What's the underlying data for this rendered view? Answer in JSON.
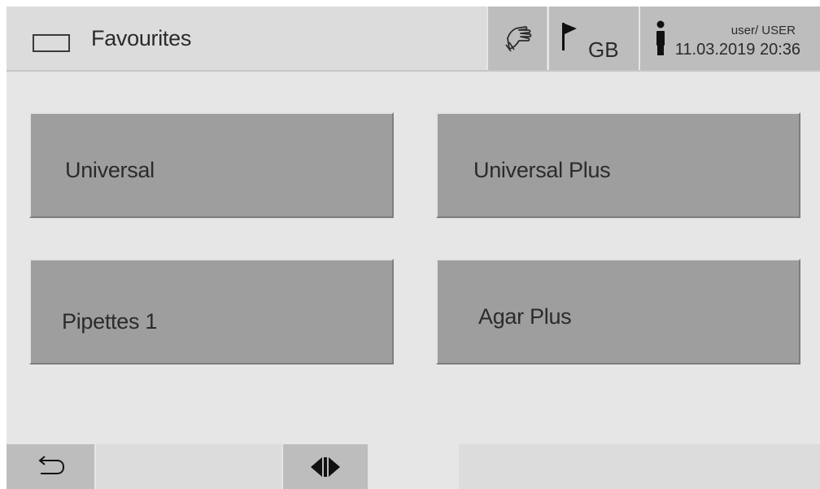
{
  "header": {
    "title": "Favourites",
    "title_icon": "screen-outline-icon",
    "touch_icon": "touch-hand-icon",
    "language": {
      "flag_icon": "flag-icon",
      "code": "GB"
    },
    "info": {
      "person_icon": "person-info-icon",
      "user": "user/ USER",
      "datetime": "11.03.2019  20:36"
    }
  },
  "favourites": [
    {
      "label": "Universal"
    },
    {
      "label": "Universal Plus"
    },
    {
      "label": "Pipettes 1"
    },
    {
      "label": "Agar Plus"
    }
  ],
  "footer": {
    "back_icon": "back-arrow-icon",
    "switch_icon": "switch-view-icon"
  },
  "colors": {
    "background": "#e6e6e6",
    "header": "#dcdcdc",
    "button": "#9e9e9e",
    "header_button": "#bdbdbd",
    "text": "#2b2b2b"
  }
}
